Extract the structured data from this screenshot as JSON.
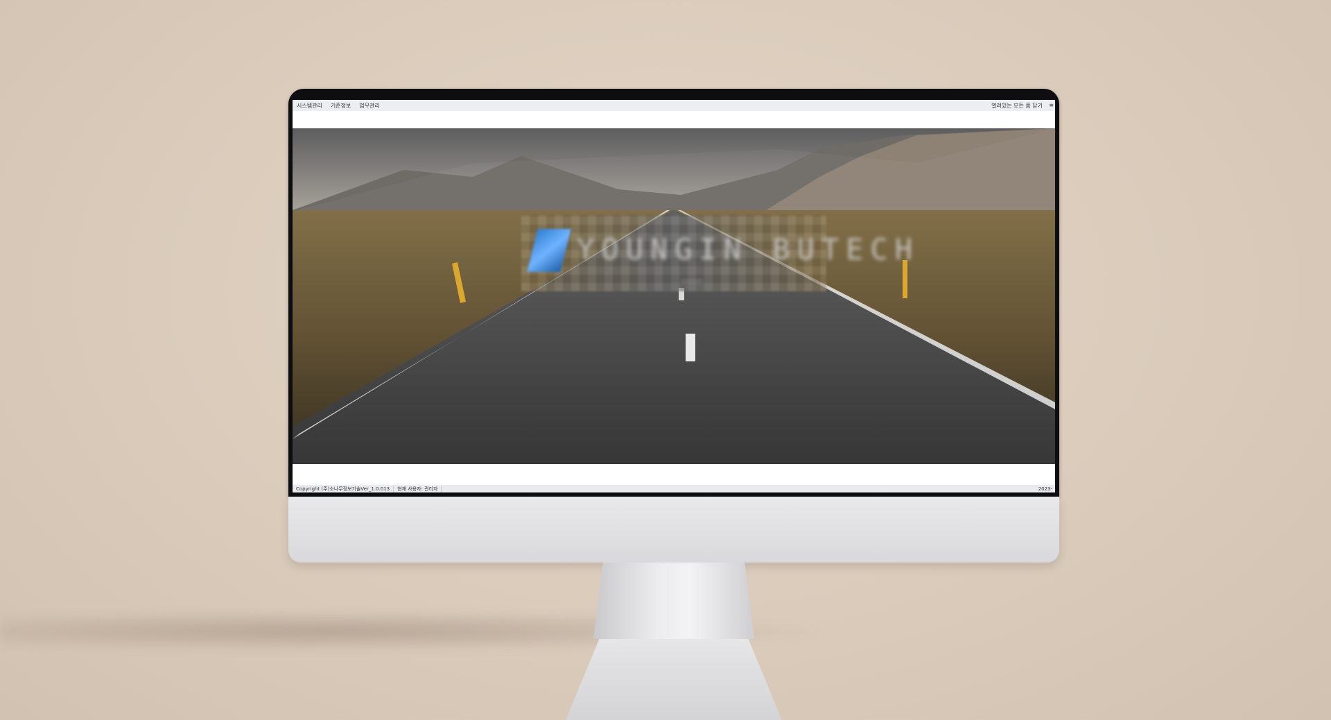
{
  "menubar": {
    "items": [
      "시스템관리",
      "기준정보",
      "업무관리"
    ],
    "close_all": "열려있는 모든 폼 닫기",
    "end_icon": "≡"
  },
  "banner": {
    "logo_text": "YOUNGIN BUTECH",
    "logo_sub": "——"
  },
  "status": {
    "copyright": "Copyright (주)소나무정보기술Ver_1.0.013",
    "user": "현재 사용자: 관리자",
    "date": "2023-"
  },
  "colors": {
    "background": "#dccdbd",
    "bezel": "#0e0e10",
    "chin": "#e2e2e4",
    "road_line": "#e9e9e9",
    "post_yellow": "#d9a427",
    "logo_blue": "#2f7fd0"
  },
  "icons": {
    "menu_end": "menu-icon"
  }
}
